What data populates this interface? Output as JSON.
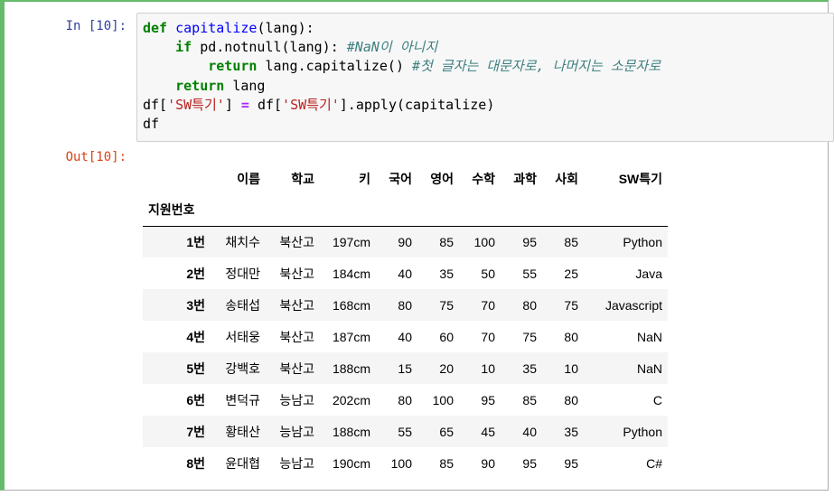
{
  "prompts": {
    "in": "In [10]:",
    "out": "Out[10]:"
  },
  "code": {
    "line1": {
      "kw": "def",
      "fn": "capitalize",
      "rest": "(lang):"
    },
    "line2": {
      "indent": "    ",
      "kw": "if",
      "rest": " pd.notnull(lang): ",
      "comment": "#NaN이 아니지"
    },
    "line3": {
      "indent": "        ",
      "kw": "return",
      "rest": " lang.capitalize() ",
      "comment": "#첫 글자는 대문자로, 나머지는 소문자로"
    },
    "line4": {
      "indent": "    ",
      "kw": "return",
      "rest": " lang"
    },
    "line5": {
      "a": "df[",
      "s1": "'SW특기'",
      "b": "] ",
      "eq": "=",
      "c": " df[",
      "s2": "'SW특기'",
      "d": "].apply(capitalize)"
    },
    "line6": "df"
  },
  "table": {
    "index_name": "지원번호",
    "columns": [
      "이름",
      "학교",
      "키",
      "국어",
      "영어",
      "수학",
      "과학",
      "사회",
      "SW특기"
    ],
    "rows": [
      {
        "index": "1번",
        "cells": [
          "채치수",
          "북산고",
          "197cm",
          "90",
          "85",
          "100",
          "95",
          "85",
          "Python"
        ]
      },
      {
        "index": "2번",
        "cells": [
          "정대만",
          "북산고",
          "184cm",
          "40",
          "35",
          "50",
          "55",
          "25",
          "Java"
        ]
      },
      {
        "index": "3번",
        "cells": [
          "송태섭",
          "북산고",
          "168cm",
          "80",
          "75",
          "70",
          "80",
          "75",
          "Javascript"
        ]
      },
      {
        "index": "4번",
        "cells": [
          "서태웅",
          "북산고",
          "187cm",
          "40",
          "60",
          "70",
          "75",
          "80",
          "NaN"
        ]
      },
      {
        "index": "5번",
        "cells": [
          "강백호",
          "북산고",
          "188cm",
          "15",
          "20",
          "10",
          "35",
          "10",
          "NaN"
        ]
      },
      {
        "index": "6번",
        "cells": [
          "변덕규",
          "능남고",
          "202cm",
          "80",
          "100",
          "95",
          "85",
          "80",
          "C"
        ]
      },
      {
        "index": "7번",
        "cells": [
          "황태산",
          "능남고",
          "188cm",
          "55",
          "65",
          "45",
          "40",
          "35",
          "Python"
        ]
      },
      {
        "index": "8번",
        "cells": [
          "윤대협",
          "능남고",
          "190cm",
          "100",
          "85",
          "90",
          "95",
          "95",
          "C#"
        ]
      }
    ]
  },
  "colors": {
    "cell_border_selected": "#66bb6a",
    "in_prompt": "#303f9f",
    "out_prompt": "#d84315",
    "keyword": "#008000",
    "function": "#0000ff",
    "comment": "#408080",
    "string": "#ba2121"
  }
}
